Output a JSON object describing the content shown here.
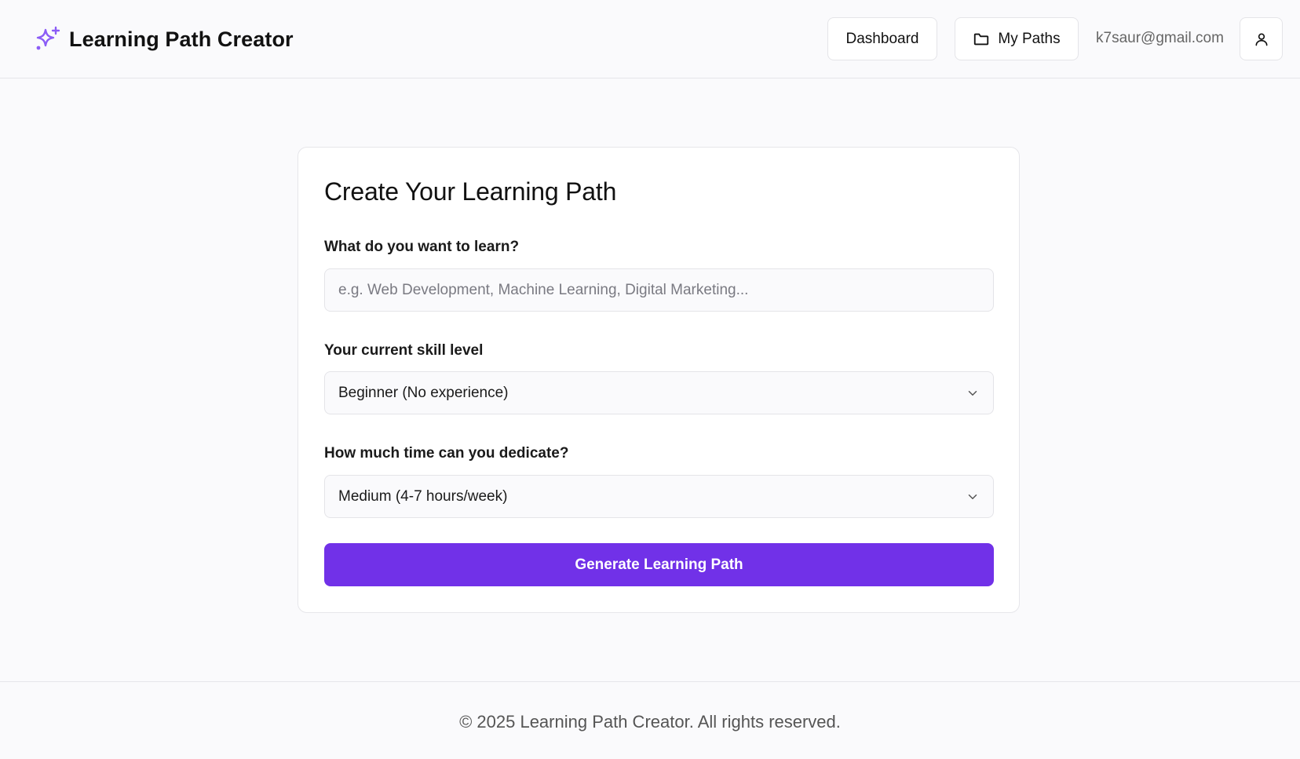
{
  "header": {
    "brand_title": "Learning Path Creator",
    "brand_icon": "sparkles-icon",
    "nav": {
      "dashboard_label": "Dashboard",
      "my_paths_label": "My Paths"
    },
    "user_email": "k7saur@gmail.com"
  },
  "form": {
    "title": "Create Your Learning Path",
    "topic": {
      "label": "What do you want to learn?",
      "value": "",
      "placeholder": "e.g. Web Development, Machine Learning, Digital Marketing..."
    },
    "skill_level": {
      "label": "Your current skill level",
      "selected": "Beginner (No experience)"
    },
    "time_commitment": {
      "label": "How much time can you dedicate?",
      "selected": "Medium (4-7 hours/week)"
    },
    "submit_label": "Generate Learning Path"
  },
  "footer": {
    "text": "© 2025 Learning Path Creator. All rights reserved."
  },
  "colors": {
    "accent": "#7131e8",
    "brand_icon": "#8b5cf6",
    "background": "#fafafc"
  }
}
